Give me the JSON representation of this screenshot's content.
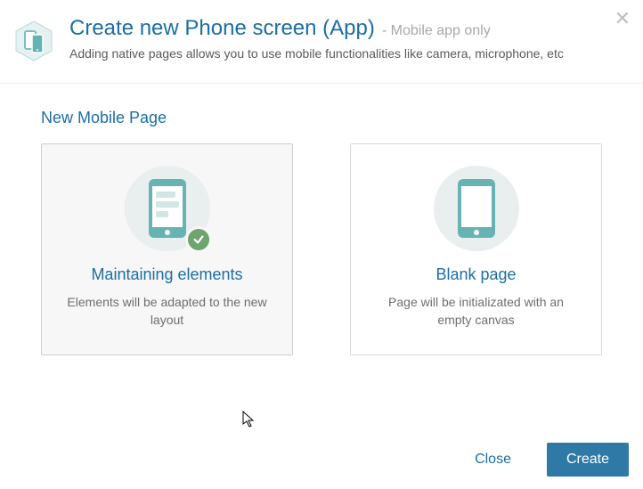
{
  "header": {
    "title": "Create new Phone screen (App)",
    "badge": "- Mobile app only",
    "subtitle": "Adding native pages allows you to use mobile functionalities like camera, microphone, etc"
  },
  "section_title": "New Mobile Page",
  "options": {
    "maintain": {
      "title": "Maintaining elements",
      "desc": "Elements will be adapted to the new layout"
    },
    "blank": {
      "title": "Blank page",
      "desc": "Page will be initializated with an empty canvas"
    }
  },
  "buttons": {
    "close": "Close",
    "create": "Create"
  }
}
